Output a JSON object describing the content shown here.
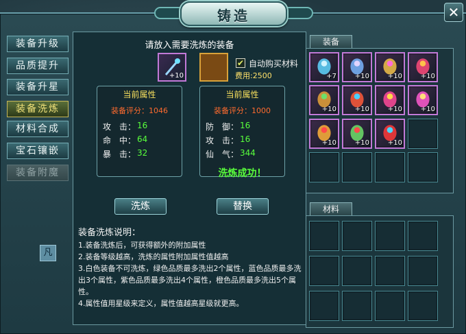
{
  "window": {
    "title": "铸造"
  },
  "sidebar": {
    "items": [
      {
        "label": "装备升级",
        "state": "normal"
      },
      {
        "label": "品质提升",
        "state": "normal"
      },
      {
        "label": "装备升星",
        "state": "normal"
      },
      {
        "label": "装备洗炼",
        "state": "active"
      },
      {
        "label": "材料合成",
        "state": "normal"
      },
      {
        "label": "宝石镶嵌",
        "state": "normal"
      },
      {
        "label": "装备附魔",
        "state": "disabled"
      }
    ]
  },
  "refine": {
    "hint": "请放入需要洗炼的装备",
    "item_count": "+10",
    "auto_buy_label": "自动购买材料",
    "fee_label": "费用",
    "fee_value": ":2500",
    "current": {
      "title": "当前属性",
      "score_label": "装备评分：",
      "score": "1046",
      "attrs": [
        {
          "name": "攻　击：",
          "value": "16"
        },
        {
          "name": "命　中：",
          "value": "64"
        },
        {
          "name": "暴　击：",
          "value": "32"
        }
      ]
    },
    "result": {
      "title": "当前属性",
      "score_label": "装备评分：",
      "score": "1000",
      "attrs": [
        {
          "name": "防　御：",
          "value": "16"
        },
        {
          "name": "攻　击：",
          "value": "16"
        },
        {
          "name": "仙　气：",
          "value": "344"
        }
      ],
      "status": "洗炼成功！"
    },
    "refine_button": "洗炼",
    "replace_button": "替换",
    "instructions": {
      "heading": "装备洗炼说明：",
      "lines": [
        "1.装备洗炼后，可获得额外的附加属性",
        "2.装备等级越高，洗炼的属性附加属性值越高",
        "3.白色装备不可洗炼，绿色品质最多洗出2个属性，蓝色品质最多洗出3个属性，紫色品质最多洗出4个属性，橙色品质最多洗出5个属性。",
        "4.属性值用星级来定义，属性值越高星级就更高。"
      ]
    }
  },
  "equipment_tab": {
    "label": "装备",
    "items": [
      {
        "icon": "sword-icon",
        "count": "+7"
      },
      {
        "icon": "staff-icon",
        "count": "+10"
      },
      {
        "icon": "necklace-icon",
        "count": "+10"
      },
      {
        "icon": "helmet-icon",
        "count": "+10"
      },
      {
        "icon": "ring-icon",
        "count": "+10"
      },
      {
        "icon": "cape-icon",
        "count": "+10"
      },
      {
        "icon": "armor-icon",
        "count": "+10"
      },
      {
        "icon": "bracer-icon",
        "count": "+10"
      },
      {
        "icon": "robe-icon",
        "count": "+10"
      },
      {
        "icon": "mask-icon",
        "count": "+10"
      },
      {
        "icon": "boots-icon",
        "count": "+10"
      }
    ]
  },
  "material_tab": {
    "label": "材料"
  },
  "colors": {
    "accent_gold": "#f7e05e",
    "success_green": "#59ff3c",
    "score_orange": "#ff6b2e",
    "purple_border": "#c27ad8"
  }
}
